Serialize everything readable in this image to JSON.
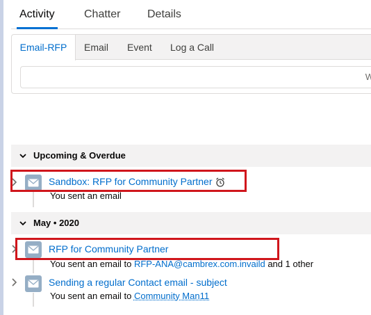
{
  "main_tabs": [
    {
      "label": "Activity",
      "active": true
    },
    {
      "label": "Chatter",
      "active": false
    },
    {
      "label": "Details",
      "active": false
    }
  ],
  "composer": {
    "tabs": [
      {
        "label": "Email-RFP",
        "active": true
      },
      {
        "label": "Email",
        "active": false
      },
      {
        "label": "Event",
        "active": false
      },
      {
        "label": "Log a Call",
        "active": false
      }
    ],
    "input_value": "W"
  },
  "sections": {
    "upcoming": {
      "title": "Upcoming & Overdue"
    },
    "month": {
      "title": "May • 2020"
    }
  },
  "items": [
    {
      "title": "Sandbox: RFP for Community Partner",
      "subtitle": "You sent an email",
      "icon": "email-icon",
      "overdue_icon": "alarm-clock-icon",
      "highlighted": true
    },
    {
      "title": "RFP for Community Partner",
      "subtitle_prefix": "You sent an email to",
      "link": "RFP-ANA@cambrex.com.invaild",
      "subtitle_suffix": "and 1 other",
      "icon": "email-icon",
      "highlighted": true
    },
    {
      "title": "Sending a regular Contact email - subject",
      "subtitle_prefix": "You sent an email to",
      "link": "Community Man11",
      "icon": "email-icon",
      "highlighted": false
    }
  ],
  "colors": {
    "accent": "#0070d2",
    "link": "#006dcc",
    "highlight": "#d0161c",
    "email_icon": "#95aec5"
  }
}
